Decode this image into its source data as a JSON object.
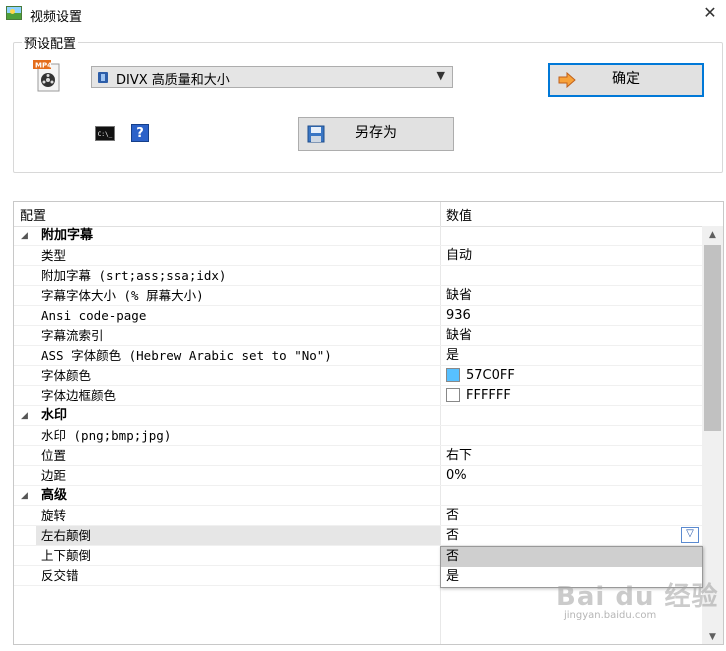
{
  "window": {
    "title": "视频设置",
    "close_glyph": "✕"
  },
  "preset": {
    "group_label": "预设配置",
    "selected": "DIVX 高质量和大小",
    "ok_label": "确定",
    "save_as_label": "另存为",
    "cmd_icon_text": "C:\\_",
    "help_icon_text": "?"
  },
  "grid": {
    "columns": [
      "配置",
      "数值"
    ],
    "rows": [
      {
        "name": "附加字幕",
        "value": "",
        "type": "section"
      },
      {
        "name": "类型",
        "value": "自动"
      },
      {
        "name": "附加字幕 (srt;ass;ssa;idx)",
        "value": ""
      },
      {
        "name": "字幕字体大小 (% 屏幕大小)",
        "value": "缺省"
      },
      {
        "name": "Ansi code-page",
        "value": "936"
      },
      {
        "name": "字幕流索引",
        "value": "缺省"
      },
      {
        "name": "ASS 字体颜色 (Hebrew Arabic set to \"No\")",
        "value": "是"
      },
      {
        "name": "字体颜色",
        "value": "57C0FF",
        "swatch": "#57C0FF"
      },
      {
        "name": "字体边框颜色",
        "value": "FFFFFF",
        "swatch": "#FFFFFF"
      },
      {
        "name": "水印",
        "value": "",
        "type": "section"
      },
      {
        "name": "水印 (png;bmp;jpg)",
        "value": ""
      },
      {
        "name": "位置",
        "value": "右下"
      },
      {
        "name": "边距",
        "value": "0%"
      },
      {
        "name": "高级",
        "value": "",
        "type": "section"
      },
      {
        "name": "旋转",
        "value": "否"
      },
      {
        "name": "左右颠倒",
        "value": "否",
        "selected": true
      },
      {
        "name": "上下颠倒",
        "value": ""
      },
      {
        "name": "反交错",
        "value": ""
      }
    ],
    "dropdown_options": [
      "否",
      "是"
    ],
    "dropdown_highlighted": 0
  },
  "watermark": {
    "main": "Bai du 经验",
    "sub": "jingyan.baidu.com"
  },
  "colors": {
    "accent": "#0078D7",
    "swatch_blue": "#57C0FF"
  }
}
